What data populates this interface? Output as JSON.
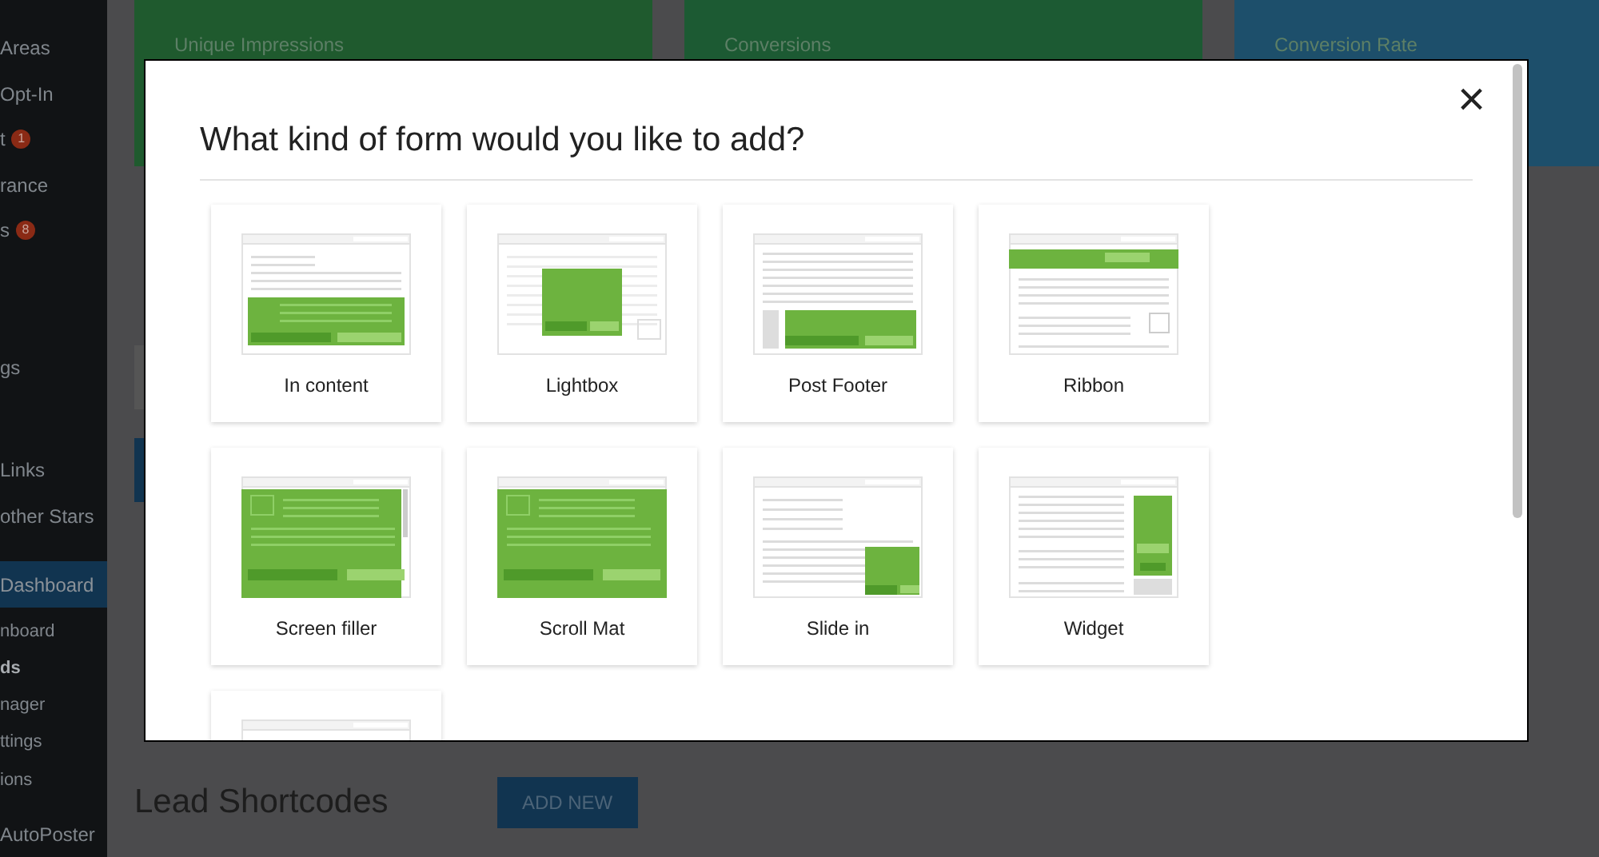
{
  "sidebar": {
    "items": [
      {
        "label": "Areas",
        "selected": false,
        "bold": false,
        "sub": false
      },
      {
        "label": "Opt-In",
        "selected": false,
        "bold": false,
        "sub": false
      },
      {
        "label": "t",
        "badge": "1",
        "selected": false,
        "bold": false,
        "sub": false
      },
      {
        "label": "rance",
        "selected": false,
        "bold": false,
        "sub": false
      },
      {
        "label": "s",
        "badge": "8",
        "selected": false,
        "bold": false,
        "sub": false
      },
      {
        "label": "gs",
        "selected": false,
        "bold": false,
        "sub": false
      },
      {
        "label": "Links",
        "selected": false,
        "bold": false,
        "sub": false
      },
      {
        "label": "other Stars",
        "selected": false,
        "bold": false,
        "sub": false
      },
      {
        "label": "Dashboard",
        "selected": true,
        "bold": false,
        "sub": false
      },
      {
        "label": "nboard",
        "selected": false,
        "bold": false,
        "sub": true
      },
      {
        "label": "ds",
        "selected": false,
        "bold": true,
        "sub": true
      },
      {
        "label": "nager",
        "selected": false,
        "bold": false,
        "sub": true
      },
      {
        "label": "ttings",
        "selected": false,
        "bold": false,
        "sub": true
      },
      {
        "label": "ions",
        "selected": false,
        "bold": false,
        "sub": true
      },
      {
        "label": "AutoPoster",
        "selected": false,
        "bold": false,
        "sub": false
      }
    ]
  },
  "stat_cards": [
    {
      "label": "Unique Impressions",
      "color": "#1f5a2e"
    },
    {
      "label": "Conversions",
      "color": "#1c5a33"
    },
    {
      "label": "Conversion Rate",
      "color": "#1d4f6b"
    }
  ],
  "footer": {
    "heading": "Lead Shortcodes",
    "button": "ADD NEW"
  },
  "modal": {
    "title": "What kind of form would you like to add?",
    "close": "×",
    "options": [
      {
        "kind": "in_content",
        "label": "In content"
      },
      {
        "kind": "lightbox",
        "label": "Lightbox"
      },
      {
        "kind": "post_footer",
        "label": "Post Footer"
      },
      {
        "kind": "ribbon",
        "label": "Ribbon"
      },
      {
        "kind": "screen_filler",
        "label": "Screen filler"
      },
      {
        "kind": "scroll_mat",
        "label": "Scroll Mat"
      },
      {
        "kind": "slide_in",
        "label": "Slide in"
      },
      {
        "kind": "widget",
        "label": "Widget"
      },
      {
        "kind": "blank"
      }
    ]
  }
}
